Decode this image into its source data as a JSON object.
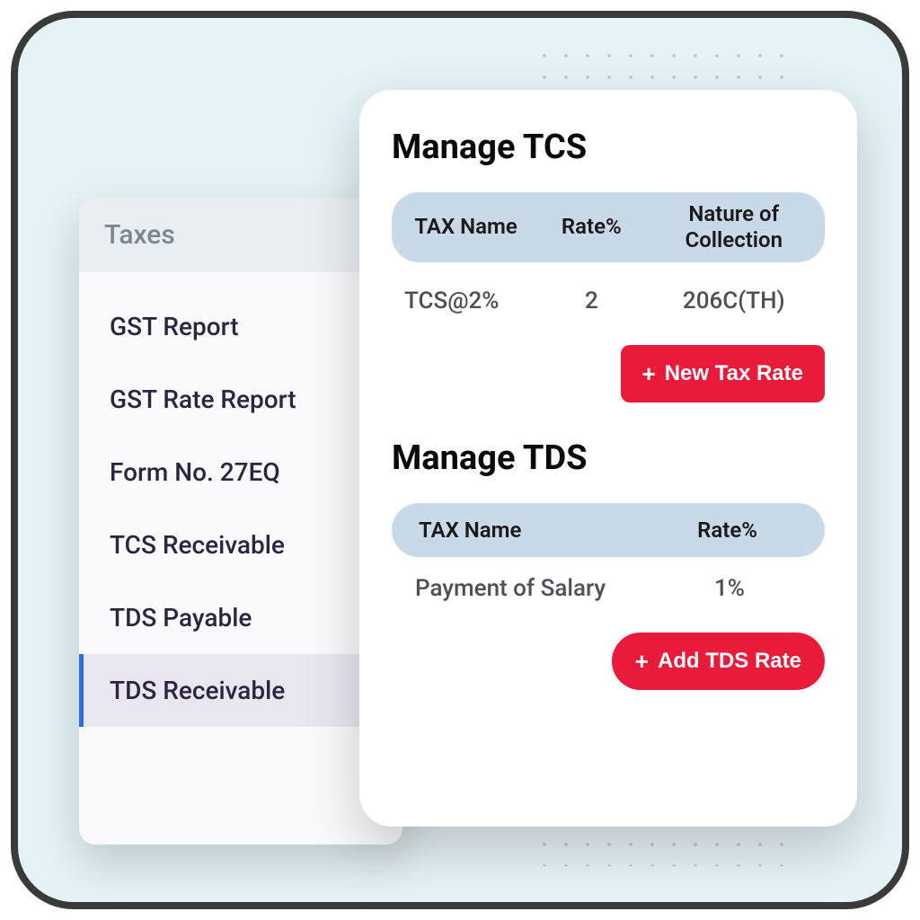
{
  "sidebar": {
    "title": "Taxes",
    "items": [
      {
        "label": "GST Report",
        "active": false
      },
      {
        "label": "GST Rate Report",
        "active": false
      },
      {
        "label": "Form No. 27EQ",
        "active": false
      },
      {
        "label": "TCS Receivable",
        "active": false
      },
      {
        "label": "TDS Payable",
        "active": false
      },
      {
        "label": "TDS Receivable",
        "active": true
      }
    ]
  },
  "tcs": {
    "title": "Manage TCS",
    "columns": [
      "TAX Name",
      "Rate%",
      "Nature of Collection"
    ],
    "row": {
      "name": "TCS@2%",
      "rate": "2",
      "nature": "206C(TH)"
    },
    "button": "New Tax Rate"
  },
  "tds": {
    "title": "Manage TDS",
    "columns": [
      "TAX Name",
      "Rate%"
    ],
    "row": {
      "name": "Payment of Salary",
      "rate": "1%"
    },
    "button": "Add TDS Rate"
  }
}
